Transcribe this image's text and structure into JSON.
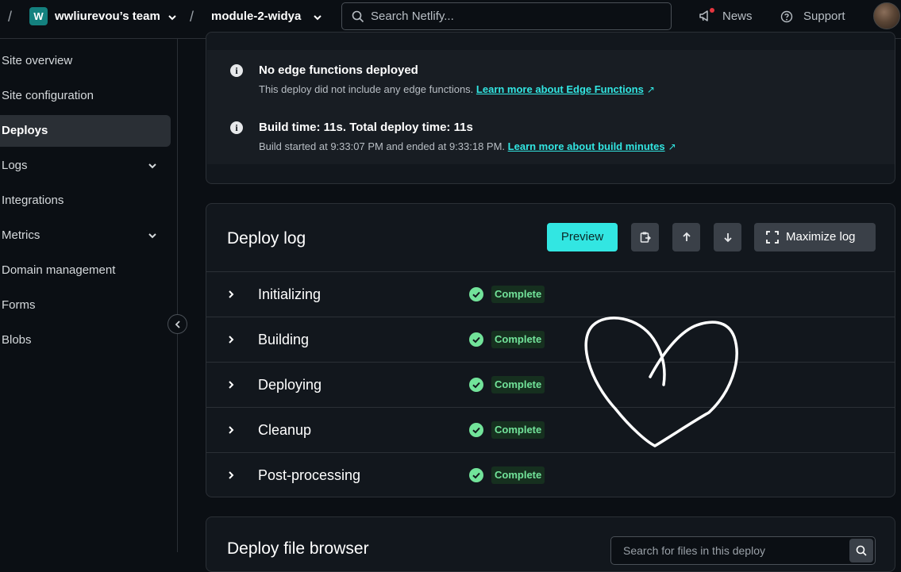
{
  "header": {
    "separator": "/",
    "team_initial": "W",
    "team_name": "wwliurevou’s team",
    "site_name": "module-2-widya",
    "search_placeholder": "Search Netlify...",
    "news_label": "News",
    "support_label": "Support"
  },
  "sidebar": {
    "items": [
      {
        "label": "Site overview"
      },
      {
        "label": "Site configuration"
      },
      {
        "label": "Deploys"
      },
      {
        "label": "Logs"
      },
      {
        "label": "Integrations"
      },
      {
        "label": "Metrics"
      },
      {
        "label": "Domain management"
      },
      {
        "label": "Forms"
      },
      {
        "label": "Blobs"
      }
    ],
    "active_label": "Deploys"
  },
  "summary": {
    "edge": {
      "title": "No edge functions deployed",
      "text": "This deploy did not include any edge functions.",
      "link": "Learn more about Edge Functions"
    },
    "build": {
      "title": "Build time: 11s. Total deploy time: 11s",
      "text": "Build started at 9:33:07 PM and ended at 9:33:18 PM.",
      "link": "Learn more about build minutes"
    }
  },
  "deploy_log": {
    "title": "Deploy log",
    "preview_label": "Preview",
    "maximize_label": "Maximize log",
    "steps": [
      {
        "name": "Initializing",
        "status": "Complete"
      },
      {
        "name": "Building",
        "status": "Complete"
      },
      {
        "name": "Deploying",
        "status": "Complete"
      },
      {
        "name": "Cleanup",
        "status": "Complete"
      },
      {
        "name": "Post-processing",
        "status": "Complete"
      }
    ]
  },
  "file_browser": {
    "title": "Deploy file browser",
    "search_placeholder": "Search for files in this deploy"
  },
  "colors": {
    "accent": "#32e6e2",
    "success": "#72e39a",
    "team_badge": "#14817f"
  }
}
